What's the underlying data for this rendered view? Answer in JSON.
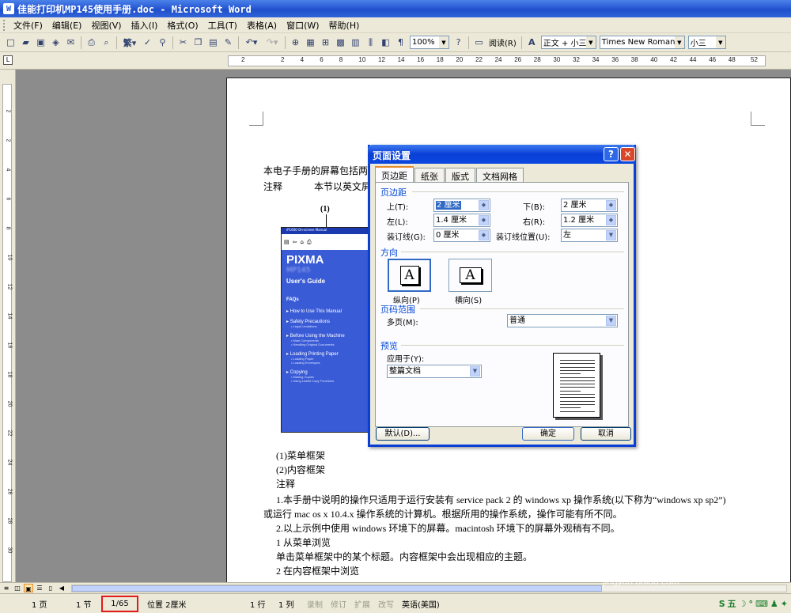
{
  "title": {
    "text": "佳能打印机MP145使用手册.doc - Microsoft Word"
  },
  "menu": [
    "文件(F)",
    "编辑(E)",
    "视图(V)",
    "插入(I)",
    "格式(O)",
    "工具(T)",
    "表格(A)",
    "窗口(W)",
    "帮助(H)"
  ],
  "toolbar": {
    "zoom": "100%",
    "read_label": "阅读(R)",
    "style": "正文 + 小三",
    "font": "Times New Roman",
    "size": "小三"
  },
  "ruler": {
    "h_ticks": [
      "2",
      "2",
      "4",
      "6",
      "8",
      "10",
      "12",
      "14",
      "16",
      "18",
      "20",
      "22",
      "24",
      "26",
      "28",
      "30",
      "32",
      "34",
      "36",
      "38",
      "40",
      "42",
      "44",
      "46",
      "48",
      "52"
    ],
    "v_ticks": [
      "2",
      "2",
      "4",
      "6",
      "8",
      "10",
      "12",
      "14",
      "16",
      "18",
      "20",
      "22",
      "24",
      "26",
      "28",
      "30"
    ]
  },
  "document": {
    "line1": "本电子手册的屏幕包括两",
    "line2a": "注释",
    "line2b": "本节以英文屏",
    "caption1": "(1)菜单框架",
    "caption2": "(2)内容框架",
    "note_head": "注释",
    "note1a": "1.本手册中说明的操作只适用于运行安装有 service pack 2 的 windows xp 操作系统(以下称为“windows xp sp2”)",
    "note1b": "或运行 mac os x 10.4.x 操作系统的计算机。根据所用的操作系统，操作可能有所不同。",
    "note2": "2.以上示例中使用 windows 环境下的屏幕。macintosh 环境下的屏幕外观稍有不同。",
    "step1_title": "1  从菜单浏览",
    "step1_body": "单击菜单框架中的某个标题。内容框架中会出现相应的主题。",
    "step2_title": "2  在内容框架中浏览"
  },
  "pixma_image": {
    "label": "(1)",
    "topbar": "iP1600 On-screen Manual",
    "nav": [
      "Show",
      "Back",
      "Home",
      "Print"
    ],
    "brand": "PIXMA",
    "model": "MP145",
    "guide": "User's Guide",
    "faqs": "FAQs",
    "items": [
      {
        "title": "How to Use This Manual",
        "subs": []
      },
      {
        "title": "Safety Precautions",
        "subs": [
          "Legal Limitations"
        ]
      },
      {
        "title": "Before Using the Machine",
        "subs": [
          "Main Components",
          "Handling Original Documents"
        ]
      },
      {
        "title": "Loading Printing Paper",
        "subs": [
          "Loading Paper",
          "Loading Envelopes"
        ]
      },
      {
        "title": "Copying",
        "subs": [
          "Making Copies",
          "Using Useful Copy Functions"
        ]
      }
    ]
  },
  "dialog": {
    "title": "页面设置",
    "tabs": [
      "页边距",
      "纸张",
      "版式",
      "文档网格"
    ],
    "margins_section": "页边距",
    "top_label": "上(T):",
    "top_value": "2 厘米",
    "bottom_label": "下(B):",
    "bottom_value": "2 厘米",
    "left_label": "左(L):",
    "left_value": "1.4 厘米",
    "right_label": "右(R):",
    "right_value": "1.2 厘米",
    "gutter_label": "装订线(G):",
    "gutter_value": "0 厘米",
    "gutter_pos_label": "装订线位置(U):",
    "gutter_pos_value": "左",
    "orientation_section": "方向",
    "portrait": "纵向(P)",
    "landscape": "横向(S)",
    "pages_section": "页码范围",
    "multi_label": "多页(M):",
    "multi_value": "普通",
    "preview_section": "预览",
    "apply_label": "应用于(Y):",
    "apply_value": "整篇文档",
    "default_button": "默认(D)...",
    "ok_button": "确定",
    "cancel_button": "取消"
  },
  "statusbar": {
    "page": "1 页",
    "section": "1 节",
    "count": "1/65",
    "position": "位置 2厘米",
    "line": "1 行",
    "col": "1 列",
    "rec": "录制",
    "trk": "修订",
    "ext": "扩展",
    "ovr": "改写",
    "lang": "英语(美国)"
  },
  "watermark": {
    "text": "Bai 经验",
    "url": "jingyan.baidu.com"
  }
}
